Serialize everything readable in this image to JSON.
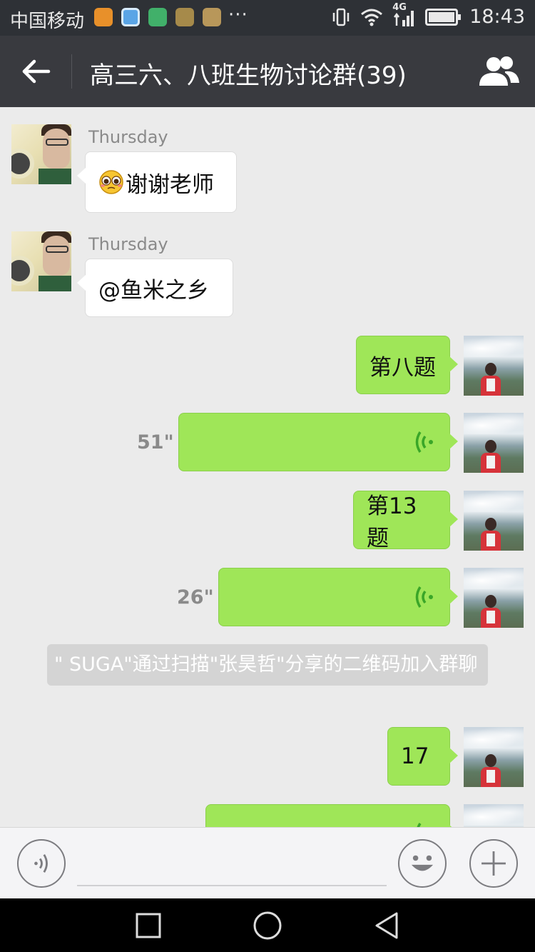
{
  "status_bar": {
    "carrier": "中国移动",
    "network": "4G",
    "time": "18:43",
    "more_indicator": "···"
  },
  "header": {
    "title": "高三六、八班生物讨论群(39)",
    "back_icon": "arrow-left-icon",
    "members_icon": "group-members-icon"
  },
  "messages": [
    {
      "side": "left",
      "time": "Thursday",
      "text": "谢谢老师",
      "emoji": "pleading-face-icon"
    },
    {
      "side": "left",
      "time": "Thursday",
      "text": "@鱼米之乡"
    },
    {
      "side": "right",
      "text": "第八题"
    },
    {
      "side": "right",
      "type": "voice",
      "duration": "51\""
    },
    {
      "side": "right",
      "text": "第13题"
    },
    {
      "side": "right",
      "type": "voice",
      "duration": "26\""
    },
    {
      "type": "system",
      "text": "\" SUGA\"通过扫描\"张昊哲\"分享的二维码加入群聊"
    },
    {
      "side": "right",
      "text": "17"
    },
    {
      "side": "right",
      "type": "voice"
    }
  ],
  "input": {
    "value": "",
    "placeholder": ""
  },
  "colors": {
    "title_bar": "#393a3f",
    "status_bar": "#2e3136",
    "chat_background": "#ebebeb",
    "bubble_sent": "#9fe658",
    "bubble_received": "#ffffff",
    "voice_wave": "#3aa628"
  }
}
